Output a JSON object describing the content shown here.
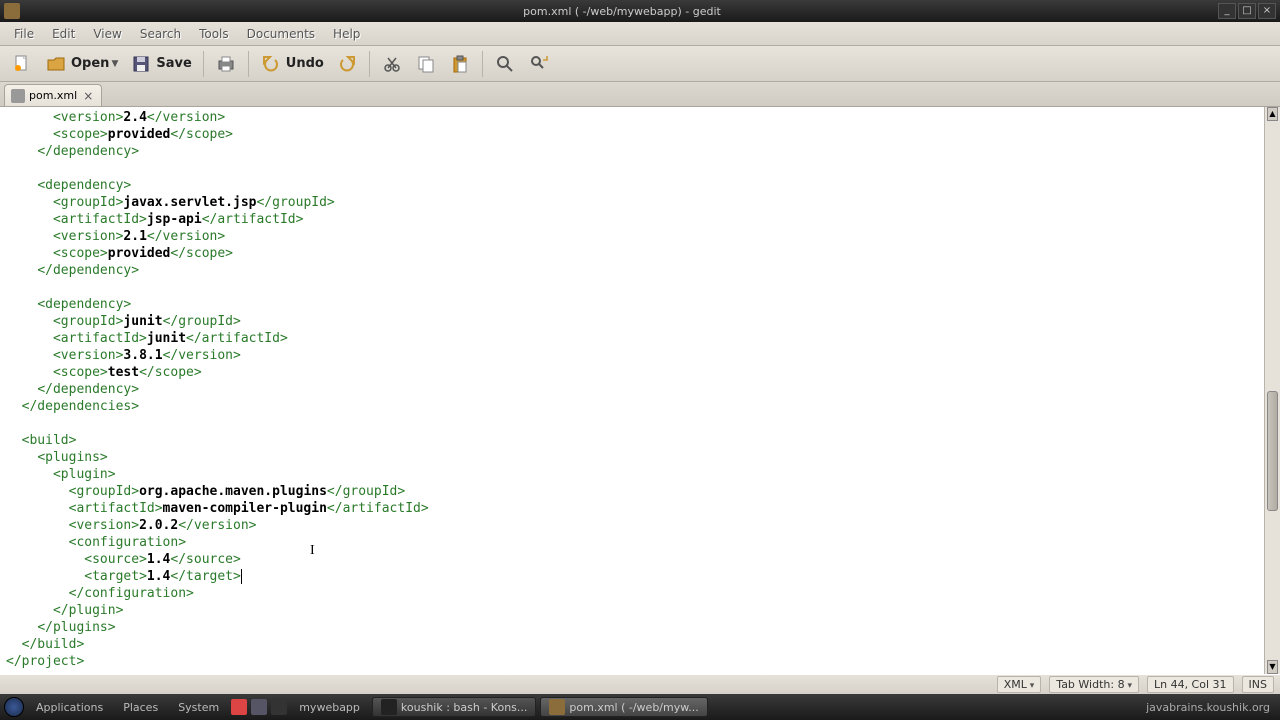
{
  "titlebar": {
    "title": "pom.xml ( -/web/mywebapp) - gedit"
  },
  "menubar": {
    "items": [
      "File",
      "Edit",
      "View",
      "Search",
      "Tools",
      "Documents",
      "Help"
    ]
  },
  "toolbar": {
    "open_label": "Open",
    "save_label": "Save",
    "undo_label": "Undo"
  },
  "tabs": {
    "items": [
      {
        "label": "pom.xml"
      }
    ]
  },
  "editor": {
    "lines": [
      {
        "indent": 6,
        "parts": [
          {
            "t": "t",
            "v": "<version>"
          },
          {
            "t": "v",
            "v": "2.4"
          },
          {
            "t": "t",
            "v": "</version>"
          }
        ]
      },
      {
        "indent": 6,
        "parts": [
          {
            "t": "t",
            "v": "<scope>"
          },
          {
            "t": "v",
            "v": "provided"
          },
          {
            "t": "t",
            "v": "</scope>"
          }
        ]
      },
      {
        "indent": 4,
        "parts": [
          {
            "t": "t",
            "v": "</dependency>"
          }
        ]
      },
      {
        "indent": 0,
        "parts": []
      },
      {
        "indent": 4,
        "parts": [
          {
            "t": "t",
            "v": "<dependency>"
          }
        ]
      },
      {
        "indent": 6,
        "parts": [
          {
            "t": "t",
            "v": "<groupId>"
          },
          {
            "t": "v",
            "v": "javax.servlet.jsp"
          },
          {
            "t": "t",
            "v": "</groupId>"
          }
        ]
      },
      {
        "indent": 6,
        "parts": [
          {
            "t": "t",
            "v": "<artifactId>"
          },
          {
            "t": "v",
            "v": "jsp-api"
          },
          {
            "t": "t",
            "v": "</artifactId>"
          }
        ]
      },
      {
        "indent": 6,
        "parts": [
          {
            "t": "t",
            "v": "<version>"
          },
          {
            "t": "v",
            "v": "2.1"
          },
          {
            "t": "t",
            "v": "</version>"
          }
        ]
      },
      {
        "indent": 6,
        "parts": [
          {
            "t": "t",
            "v": "<scope>"
          },
          {
            "t": "v",
            "v": "provided"
          },
          {
            "t": "t",
            "v": "</scope>"
          }
        ]
      },
      {
        "indent": 4,
        "parts": [
          {
            "t": "t",
            "v": "</dependency>"
          }
        ]
      },
      {
        "indent": 0,
        "parts": []
      },
      {
        "indent": 4,
        "parts": [
          {
            "t": "t",
            "v": "<dependency>"
          }
        ]
      },
      {
        "indent": 6,
        "parts": [
          {
            "t": "t",
            "v": "<groupId>"
          },
          {
            "t": "v",
            "v": "junit"
          },
          {
            "t": "t",
            "v": "</groupId>"
          }
        ]
      },
      {
        "indent": 6,
        "parts": [
          {
            "t": "t",
            "v": "<artifactId>"
          },
          {
            "t": "v",
            "v": "junit"
          },
          {
            "t": "t",
            "v": "</artifactId>"
          }
        ]
      },
      {
        "indent": 6,
        "parts": [
          {
            "t": "t",
            "v": "<version>"
          },
          {
            "t": "v",
            "v": "3.8.1"
          },
          {
            "t": "t",
            "v": "</version>"
          }
        ]
      },
      {
        "indent": 6,
        "parts": [
          {
            "t": "t",
            "v": "<scope>"
          },
          {
            "t": "v",
            "v": "test"
          },
          {
            "t": "t",
            "v": "</scope>"
          }
        ]
      },
      {
        "indent": 4,
        "parts": [
          {
            "t": "t",
            "v": "</dependency>"
          }
        ]
      },
      {
        "indent": 2,
        "parts": [
          {
            "t": "t",
            "v": "</dependencies>"
          }
        ]
      },
      {
        "indent": 0,
        "parts": []
      },
      {
        "indent": 2,
        "parts": [
          {
            "t": "t",
            "v": "<build>"
          }
        ]
      },
      {
        "indent": 4,
        "parts": [
          {
            "t": "t",
            "v": "<plugins>"
          }
        ]
      },
      {
        "indent": 6,
        "parts": [
          {
            "t": "t",
            "v": "<plugin>"
          }
        ]
      },
      {
        "indent": 8,
        "parts": [
          {
            "t": "t",
            "v": "<groupId>"
          },
          {
            "t": "v",
            "v": "org.apache.maven.plugins"
          },
          {
            "t": "t",
            "v": "</groupId>"
          }
        ]
      },
      {
        "indent": 8,
        "parts": [
          {
            "t": "t",
            "v": "<artifactId>"
          },
          {
            "t": "v",
            "v": "maven-compiler-plugin"
          },
          {
            "t": "t",
            "v": "</artifactId>"
          }
        ]
      },
      {
        "indent": 8,
        "parts": [
          {
            "t": "t",
            "v": "<version>"
          },
          {
            "t": "v",
            "v": "2.0.2"
          },
          {
            "t": "t",
            "v": "</version>"
          }
        ]
      },
      {
        "indent": 8,
        "parts": [
          {
            "t": "t",
            "v": "<configuration>"
          }
        ]
      },
      {
        "indent": 10,
        "parts": [
          {
            "t": "t",
            "v": "<source>"
          },
          {
            "t": "v",
            "v": "1.4"
          },
          {
            "t": "t",
            "v": "</source>"
          }
        ]
      },
      {
        "indent": 10,
        "parts": [
          {
            "t": "t",
            "v": "<target>"
          },
          {
            "t": "v",
            "v": "1.4"
          },
          {
            "t": "t",
            "v": "</target>"
          }
        ],
        "cursor_after": true
      },
      {
        "indent": 8,
        "parts": [
          {
            "t": "t",
            "v": "</configuration>"
          }
        ]
      },
      {
        "indent": 6,
        "parts": [
          {
            "t": "t",
            "v": "</plugin>"
          }
        ]
      },
      {
        "indent": 4,
        "parts": [
          {
            "t": "t",
            "v": "</plugins>"
          }
        ]
      },
      {
        "indent": 2,
        "parts": [
          {
            "t": "t",
            "v": "</build>"
          }
        ]
      },
      {
        "indent": 0,
        "parts": [
          {
            "t": "t",
            "v": "</project>"
          }
        ]
      }
    ],
    "caret_marker_line": 27
  },
  "statusbar": {
    "language": "XML",
    "tabwidth": "Tab Width: 8",
    "position": "Ln 44, Col 31",
    "insert_mode": "INS"
  },
  "taskbar": {
    "menu1": "Applications",
    "menu2": "Places",
    "menu3": "System",
    "items": [
      {
        "label": "koushik : bash - Kons...",
        "active": false
      },
      {
        "label": "pom.xml ( -/web/myw...",
        "active": true
      }
    ],
    "tray_text": "javabrains.koushik.org"
  }
}
